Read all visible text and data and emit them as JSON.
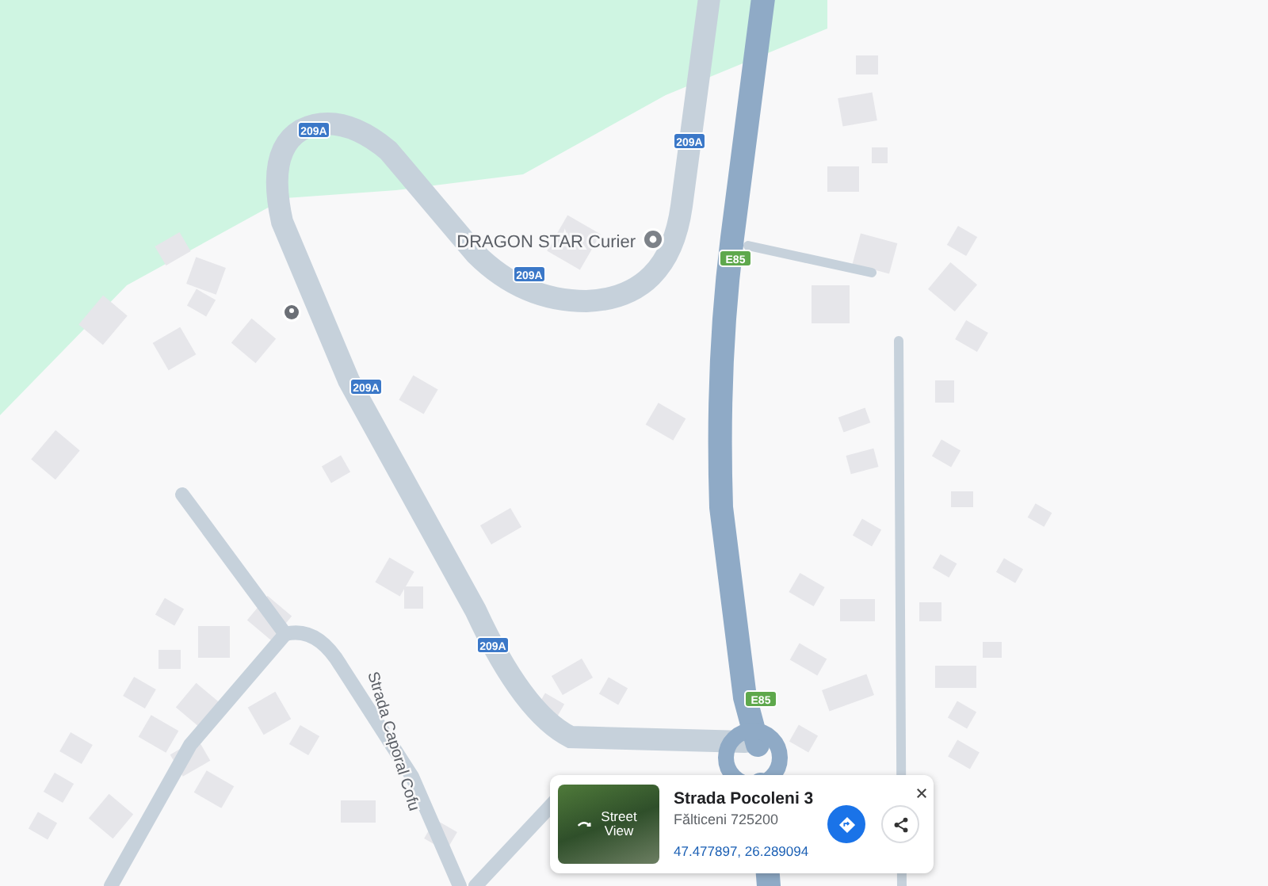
{
  "map": {
    "road_shields": [
      {
        "label": "209A",
        "kind": "national"
      },
      {
        "label": "209A",
        "kind": "national"
      },
      {
        "label": "209A",
        "kind": "national"
      },
      {
        "label": "209A",
        "kind": "national"
      },
      {
        "label": "209A",
        "kind": "national"
      },
      {
        "label": "E85",
        "kind": "european"
      },
      {
        "label": "E85",
        "kind": "european"
      }
    ],
    "place_label": "DRAGON STAR Curier",
    "street_label": "Strada Caporal Cofu"
  },
  "info_card": {
    "photo_label": "Street View",
    "title": "Strada Pocoleni 3",
    "subtitle": "Fălticeni 725200",
    "coordinates": "47.477897, 26.289094"
  }
}
